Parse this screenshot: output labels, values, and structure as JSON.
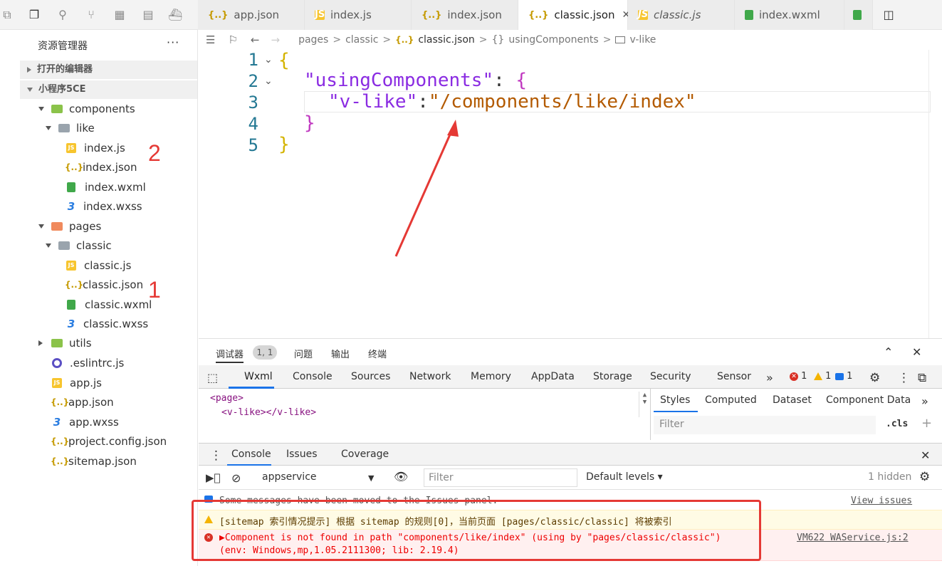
{
  "tabs": [
    {
      "label": "app.json",
      "icon": "json-file-icon"
    },
    {
      "label": "index.js",
      "icon": "js-file-icon"
    },
    {
      "label": "index.json",
      "icon": "json-file-icon"
    },
    {
      "label": "classic.json",
      "icon": "json-file-icon",
      "active": true
    },
    {
      "label": "classic.js",
      "icon": "js-file-icon"
    },
    {
      "label": "index.wxml",
      "icon": "wxml-file-icon"
    }
  ],
  "sidebar": {
    "title": "资源管理器",
    "more": "···",
    "open_editors": "打开的编辑器",
    "project": "小程序5CE",
    "tree": [
      {
        "label": "components"
      },
      {
        "label": "like"
      },
      {
        "label": "index.js"
      },
      {
        "label": "index.json"
      },
      {
        "label": "index.wxml"
      },
      {
        "label": "index.wxss"
      },
      {
        "label": "pages"
      },
      {
        "label": "classic"
      },
      {
        "label": "classic.js"
      },
      {
        "label": "classic.json"
      },
      {
        "label": "classic.wxml"
      },
      {
        "label": "classic.wxss"
      },
      {
        "label": "utils"
      },
      {
        "label": ".eslintrc.js"
      },
      {
        "label": "app.js"
      },
      {
        "label": "app.json"
      },
      {
        "label": "app.wxss"
      },
      {
        "label": "project.config.json"
      },
      {
        "label": "sitemap.json"
      }
    ],
    "annotations": [
      "2",
      "1"
    ]
  },
  "breadcrumb": {
    "items": [
      "pages",
      "classic",
      "classic.json",
      "usingComponents",
      "v-like"
    ],
    "sep": ">"
  },
  "editor": {
    "line_numbers": [
      "1",
      "2",
      "3",
      "4",
      "5"
    ],
    "lines": {
      "l1_brace": "{",
      "l2_key": "\"usingComponents\"",
      "l2_colon": ": ",
      "l2_brace": "{",
      "l3_key": "\"v-like\"",
      "l3_colon": ":",
      "l3_val": "\"/components/like/index\"",
      "l4_brace": "}",
      "l5_brace": "}"
    }
  },
  "debugger": {
    "tabs": [
      "调试器",
      "问题",
      "输出",
      "终端"
    ],
    "badge": "1, 1",
    "devtools_tabs": [
      "Wxml",
      "Console",
      "Sources",
      "Network",
      "Memory",
      "AppData",
      "Storage",
      "Security",
      "Sensor"
    ],
    "overflow": "»",
    "counts": {
      "errors": "1",
      "warnings": "1",
      "messages": "1"
    },
    "dom": {
      "line1": "<page>",
      "line2_open": "<v-like>",
      "line2_close": "</v-like>"
    },
    "styles_tabs": [
      "Styles",
      "Computed",
      "Dataset",
      "Component Data"
    ],
    "styles_filter": "Filter",
    "cls": ".cls",
    "plus": "+"
  },
  "console": {
    "tabs": [
      "Console",
      "Issues",
      "Coverage"
    ],
    "context": "appservice",
    "filter_placeholder": "Filter",
    "levels": "Default levels ▾",
    "hidden": "1 hidden",
    "info_msg": "Some messages have been moved to the Issues panel.",
    "view_issues": "View issues",
    "warn_msg": "[sitemap 索引情况提示] 根据 sitemap 的规则[0]，当前页面 [pages/classic/classic] 将被索引",
    "err_msg": "▶Component is not found in path \"components/like/index\" (using by \"pages/classic/classic\")",
    "err_env": "(env: Windows,mp,1.05.2111300; lib: 2.19.4)",
    "err_link": "VM622 WAService.js:2"
  },
  "colors": {
    "accent": "#1a73e8",
    "annotation": "#e53935"
  }
}
